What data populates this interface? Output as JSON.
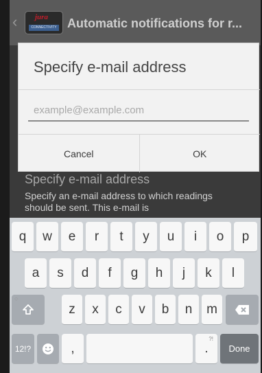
{
  "action_bar": {
    "back_icon": "chevron-left-icon",
    "logo_word": "jura",
    "logo_sub": "CONNECTIVITY",
    "title": "Automatic notifications for r..."
  },
  "background_setting": {
    "title": "Specify e-mail address",
    "description": "Specify an e-mail address to which readings should be sent. This e-mail is"
  },
  "dialog": {
    "title": "Specify e-mail address",
    "email_placeholder": "example@example.com",
    "email_value": "",
    "cancel_label": "Cancel",
    "ok_label": "OK"
  },
  "keyboard": {
    "row1": [
      "q",
      "w",
      "e",
      "r",
      "t",
      "y",
      "u",
      "i",
      "o",
      "p"
    ],
    "row2": [
      "a",
      "s",
      "d",
      "f",
      "g",
      "h",
      "j",
      "k",
      "l"
    ],
    "row3": [
      "z",
      "x",
      "c",
      "v",
      "b",
      "n",
      "m"
    ],
    "shift_icon": "shift-arrow-icon",
    "backspace_icon": "backspace-icon",
    "symbols_label": "12!?",
    "emoji_icon": "smiley-icon",
    "comma_label": ",",
    "period_label": ".",
    "period_hint": "?!",
    "done_label": "Done"
  },
  "colors": {
    "action_bar": "#5a5a5a",
    "dialog_bg": "#f2f2f2",
    "keyboard_bg": "#cdd1d5",
    "done_key": "#6f7479",
    "logo_red": "#c21e2a"
  }
}
